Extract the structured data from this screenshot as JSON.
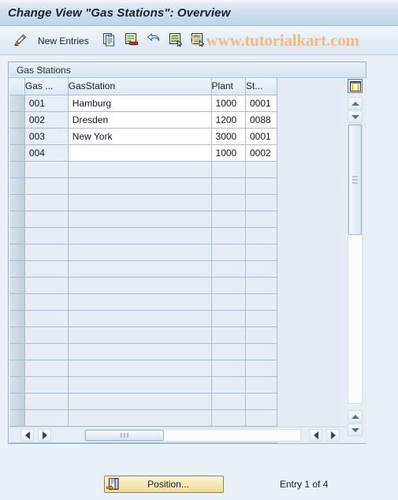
{
  "window": {
    "title": "Change View \"Gas Stations\": Overview"
  },
  "toolbar": {
    "display_change_icon": "pencil-display-change-icon",
    "new_entries_label": "New Entries",
    "copy_icon": "copy-as-icon",
    "delete_icon": "delete-icon",
    "undo_icon": "undo-icon",
    "select_all_icon": "select-all-icon",
    "deselect_all_icon": "deselect-all-icon",
    "watermark": "© www.tutorialkart.com"
  },
  "group": {
    "title": "Gas Stations"
  },
  "table": {
    "columns": [
      {
        "key": "gas",
        "label": "Gas ..."
      },
      {
        "key": "name",
        "label": "GasStation"
      },
      {
        "key": "plant",
        "label": "Plant"
      },
      {
        "key": "st",
        "label": "St..."
      }
    ],
    "rows": [
      {
        "gas": "001",
        "name": "Hamburg",
        "plant": "1000",
        "st": "0001"
      },
      {
        "gas": "002",
        "name": "Dresden",
        "plant": "1200",
        "st": "0088"
      },
      {
        "gas": "003",
        "name": "New York",
        "plant": "3000",
        "st": "0001"
      },
      {
        "gas": "004",
        "name": "",
        "plant": "1000",
        "st": "0002"
      }
    ],
    "empty_row_count": 17,
    "column_config_icon": "column-configuration-icon",
    "scroll_up_icon": "scroll-up-icon",
    "scroll_down_icon": "scroll-down-icon",
    "scroll_left_icon": "scroll-left-icon",
    "scroll_right_icon": "scroll-right-icon"
  },
  "footer": {
    "position_icon": "position-icon",
    "position_label": "Position...",
    "entry_status": "Entry 1 of 4"
  },
  "colors": {
    "title_bar": "#bcd4ea",
    "background": "#eaf0f7",
    "grid_line": "#a9bcd0",
    "button_yellow": "#f7e9b4",
    "watermark": "#eebb88"
  }
}
